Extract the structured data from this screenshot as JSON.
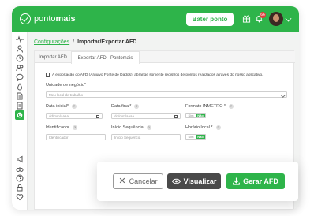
{
  "brand": {
    "logo_light": "ponto",
    "logo_bold": "mais",
    "color": "#2eb44a"
  },
  "header": {
    "clock_button": "Bater ponto",
    "notif_count": "66"
  },
  "breadcrumb": {
    "parent": "Configurações",
    "separator": "/",
    "current": "Importar/Exportar AFD"
  },
  "tabs": [
    {
      "label": "Importar AFD"
    },
    {
      "label": "Exportar AFD - Pontomais"
    }
  ],
  "info_text": "A exportação do AFD (Arquivo Fonte de Dados), abrange somente registros de pontos realizados através do nosso aplicativo.",
  "form": {
    "unidade": {
      "label": "Unidade de negócio*",
      "placeholder": "Meu local de trabalho"
    },
    "data_inicial": {
      "label": "Data inicial*",
      "placeholder": "dd/mm/aaaa"
    },
    "data_final": {
      "label": "Data final*",
      "placeholder": "dd/mm/aaaa"
    },
    "formato": {
      "label": "Formato INMETRO *",
      "yes": "Sim",
      "no": "Não"
    },
    "identificador": {
      "label": "Identificador",
      "placeholder": "Identificador"
    },
    "inicio_seq": {
      "label": "Início Sequência",
      "placeholder": "Início Sequência"
    },
    "horario": {
      "label": "Horário local *",
      "yes": "Sim",
      "no": "Não"
    }
  },
  "actions": {
    "cancel": "Cancelar",
    "preview": "Visualizar",
    "generate": "Gerar AFD"
  }
}
